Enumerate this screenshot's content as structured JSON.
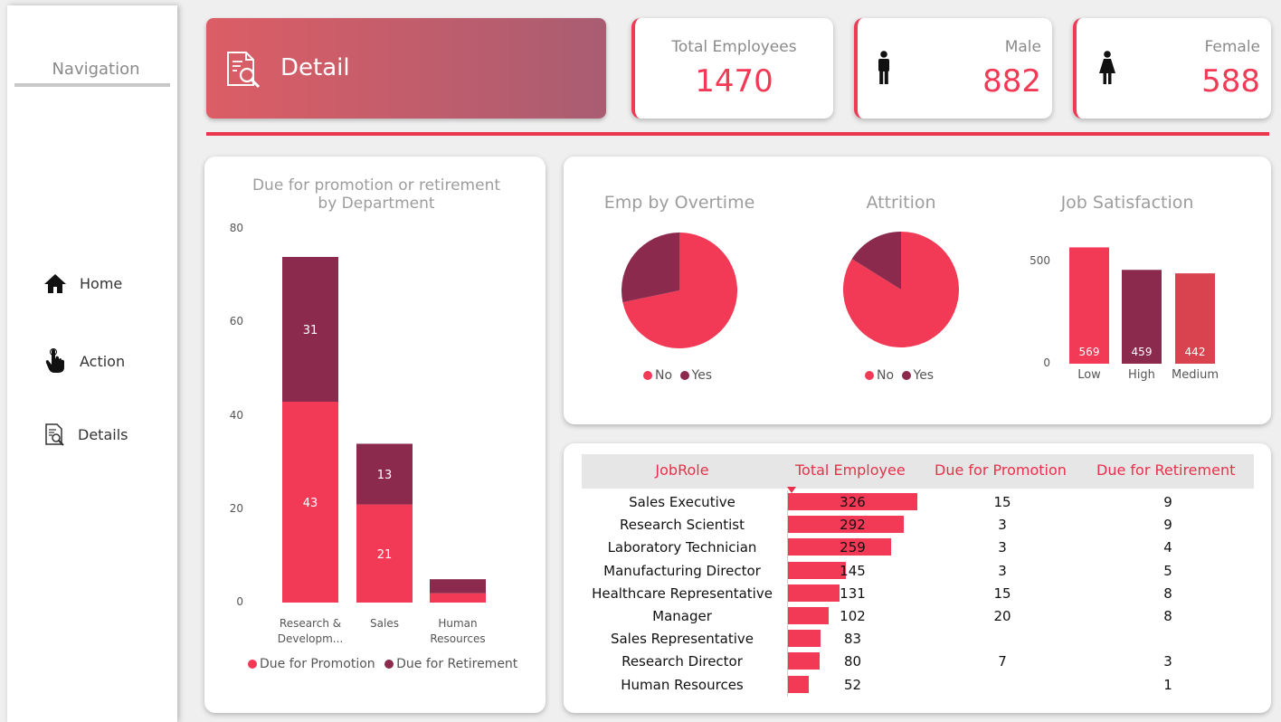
{
  "nav": {
    "title": "Navigation",
    "items": [
      {
        "label": "Home",
        "icon": "home-icon"
      },
      {
        "label": "Action",
        "icon": "hand-pointer-icon"
      },
      {
        "label": "Details",
        "icon": "document-search-icon"
      }
    ]
  },
  "header": {
    "title": "Detail",
    "icon": "document-search-icon"
  },
  "kpis": {
    "total": {
      "label": "Total Employees",
      "value": "1470"
    },
    "male": {
      "label": "Male",
      "value": "882",
      "icon": "male-icon"
    },
    "female": {
      "label": "Female",
      "value": "588",
      "icon": "female-icon"
    }
  },
  "colors": {
    "primary": "#f23955",
    "secondary": "#8b2a4c",
    "tertiary": "#d9434f"
  },
  "chart_data": [
    {
      "type": "bar",
      "stacked": true,
      "title": "Due for promotion or retirement by Department",
      "categories": [
        "Research & Developm...",
        "Sales",
        "Human Resources"
      ],
      "series": [
        {
          "name": "Due for Promotion",
          "values": [
            43,
            21,
            2
          ],
          "labels": [
            "43",
            "21",
            ""
          ]
        },
        {
          "name": "Due for Retirement",
          "values": [
            31,
            13,
            3
          ],
          "labels": [
            "31",
            "13",
            ""
          ]
        }
      ],
      "yticks": [
        "0",
        "20",
        "40",
        "60",
        "80"
      ],
      "ylim": [
        0,
        80
      ],
      "legend": "bottom"
    },
    {
      "type": "pie",
      "title": "Emp by Overtime",
      "labels": [
        "No",
        "Yes"
      ],
      "values": [
        1054,
        416
      ],
      "legend": "bottom"
    },
    {
      "type": "pie",
      "title": "Attrition",
      "labels": [
        "No",
        "Yes"
      ],
      "values": [
        1233,
        237
      ],
      "legend": "bottom"
    },
    {
      "type": "bar",
      "title": "Job Satisfaction",
      "categories": [
        "Low",
        "High",
        "Medium"
      ],
      "values": [
        569,
        459,
        442
      ],
      "yticks": [
        "0",
        "500"
      ],
      "ylim": [
        0,
        600
      ]
    }
  ],
  "table": {
    "columns": [
      "JobRole",
      "Total Employee",
      "Due for Promotion",
      "Due for Retirement"
    ],
    "rows": [
      {
        "role": "Sales Executive",
        "total": 326,
        "promotion": "15",
        "retirement": "9"
      },
      {
        "role": "Research Scientist",
        "total": 292,
        "promotion": "3",
        "retirement": "9"
      },
      {
        "role": "Laboratory Technician",
        "total": 259,
        "promotion": "3",
        "retirement": "4"
      },
      {
        "role": "Manufacturing Director",
        "total": 145,
        "promotion": "3",
        "retirement": "5"
      },
      {
        "role": "Healthcare Representative",
        "total": 131,
        "promotion": "15",
        "retirement": "8"
      },
      {
        "role": "Manager",
        "total": 102,
        "promotion": "20",
        "retirement": "8"
      },
      {
        "role": "Sales Representative",
        "total": 83,
        "promotion": "",
        "retirement": ""
      },
      {
        "role": "Research Director",
        "total": 80,
        "promotion": "7",
        "retirement": "3"
      },
      {
        "role": "Human Resources",
        "total": 52,
        "promotion": "",
        "retirement": "1"
      }
    ]
  }
}
